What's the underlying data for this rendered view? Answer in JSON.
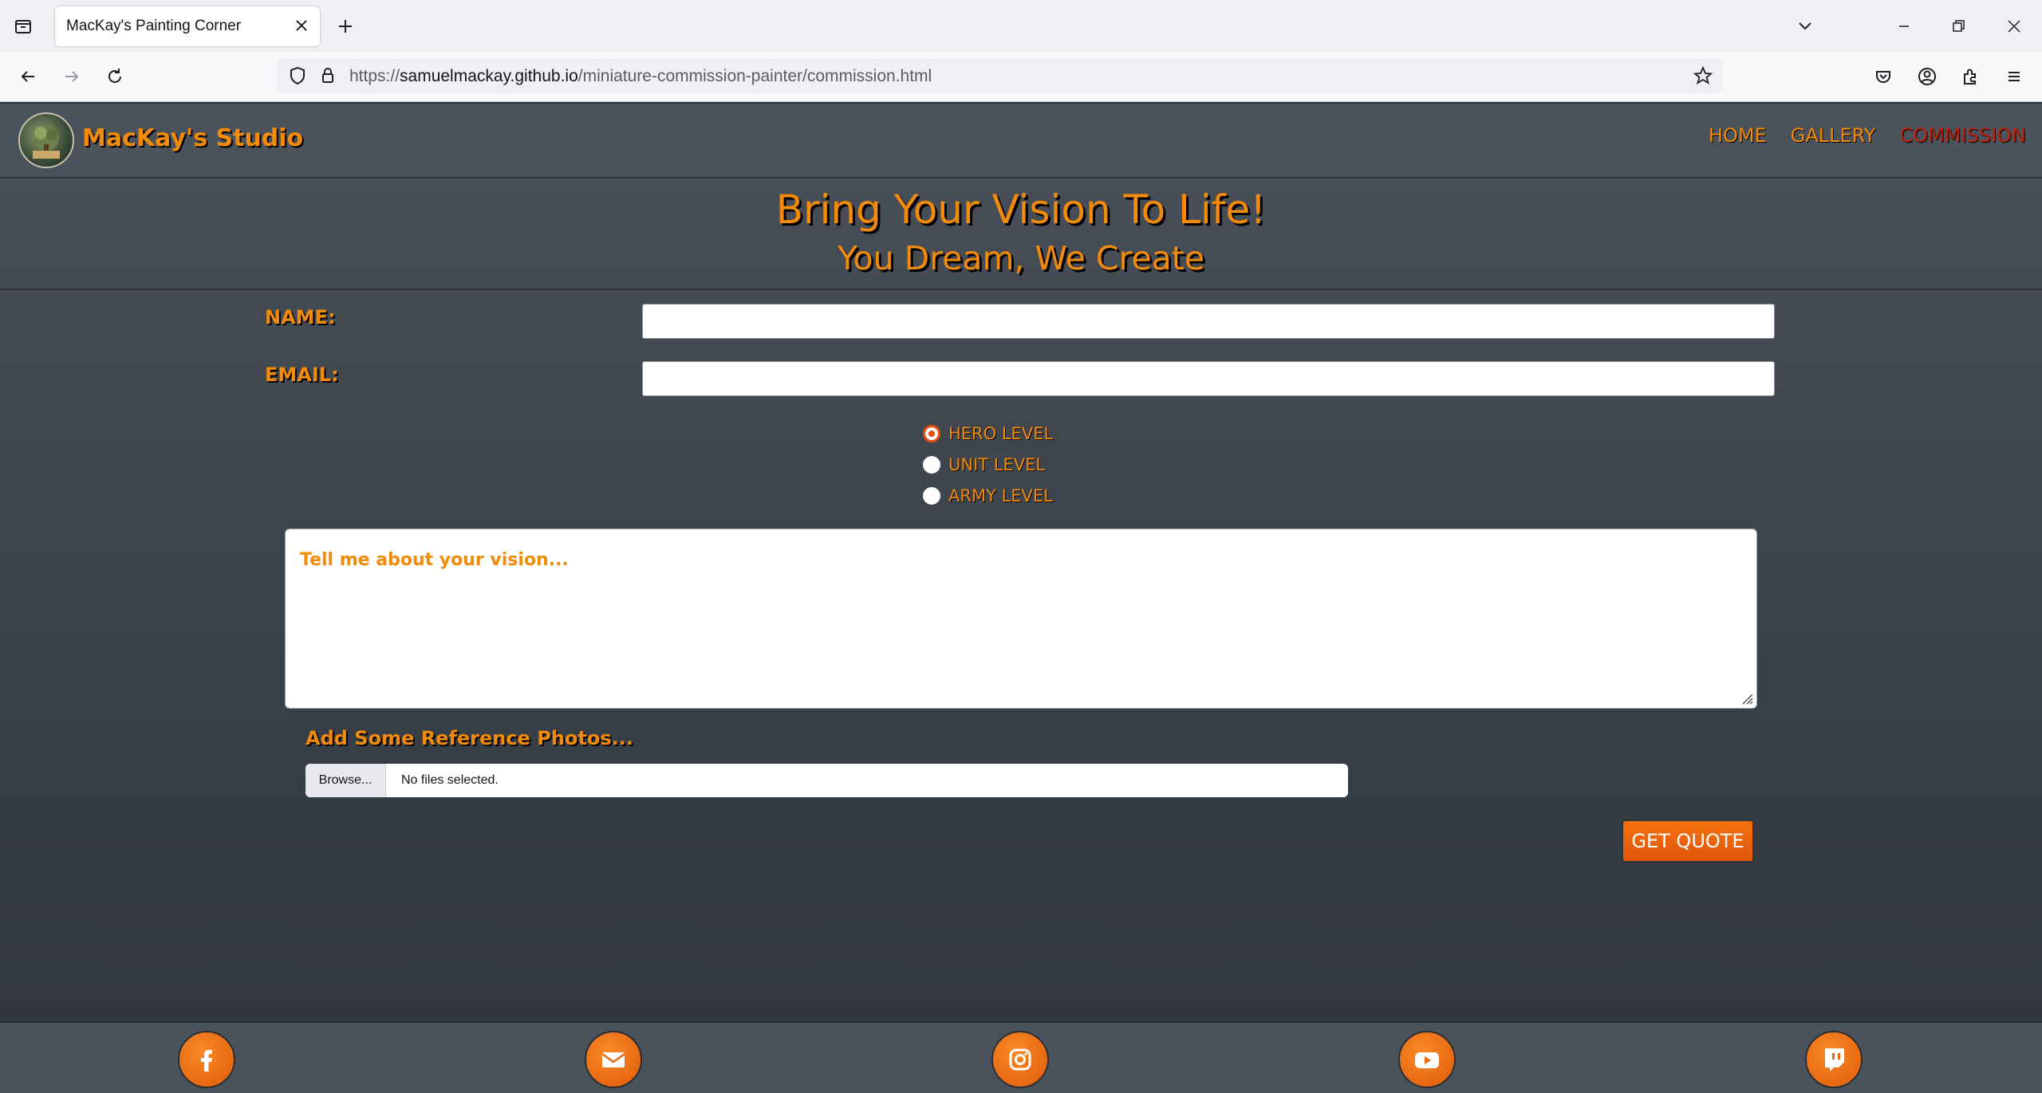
{
  "browser": {
    "tab_title": "MacKay's Painting Corner",
    "url_prefix": "https://",
    "url_host": "samuelmackay.github.io",
    "url_path": "/miniature-commission-painter/commission.html"
  },
  "site": {
    "brand": "MacKay's Studio",
    "nav": [
      {
        "label": "HOME"
      },
      {
        "label": "GALLERY"
      },
      {
        "label": "COMMISSION",
        "active": true
      }
    ]
  },
  "hero": {
    "title": "Bring Your Vision To Life!",
    "subtitle": "You Dream, We Create"
  },
  "form": {
    "name_label": "NAME:",
    "email_label": "EMAIL:",
    "name_value": "",
    "email_value": "",
    "levels": [
      {
        "label": "HERO LEVEL",
        "checked": true
      },
      {
        "label": "UNIT LEVEL",
        "checked": false
      },
      {
        "label": "ARMY LEVEL",
        "checked": false
      }
    ],
    "vision_placeholder": "Tell me about your vision...",
    "reference_label": "Add Some Reference Photos...",
    "browse_label": "Browse...",
    "file_status": "No files selected.",
    "submit_label": "GET QUOTE"
  },
  "footer": {
    "social_icons": [
      "facebook-icon",
      "email-icon",
      "instagram-icon",
      "youtube-icon",
      "twitch-icon"
    ]
  },
  "colors": {
    "accent": "#f28a0a",
    "active_nav": "#c0200a",
    "button": "#e4510b",
    "header_bg": "#4a525b"
  }
}
